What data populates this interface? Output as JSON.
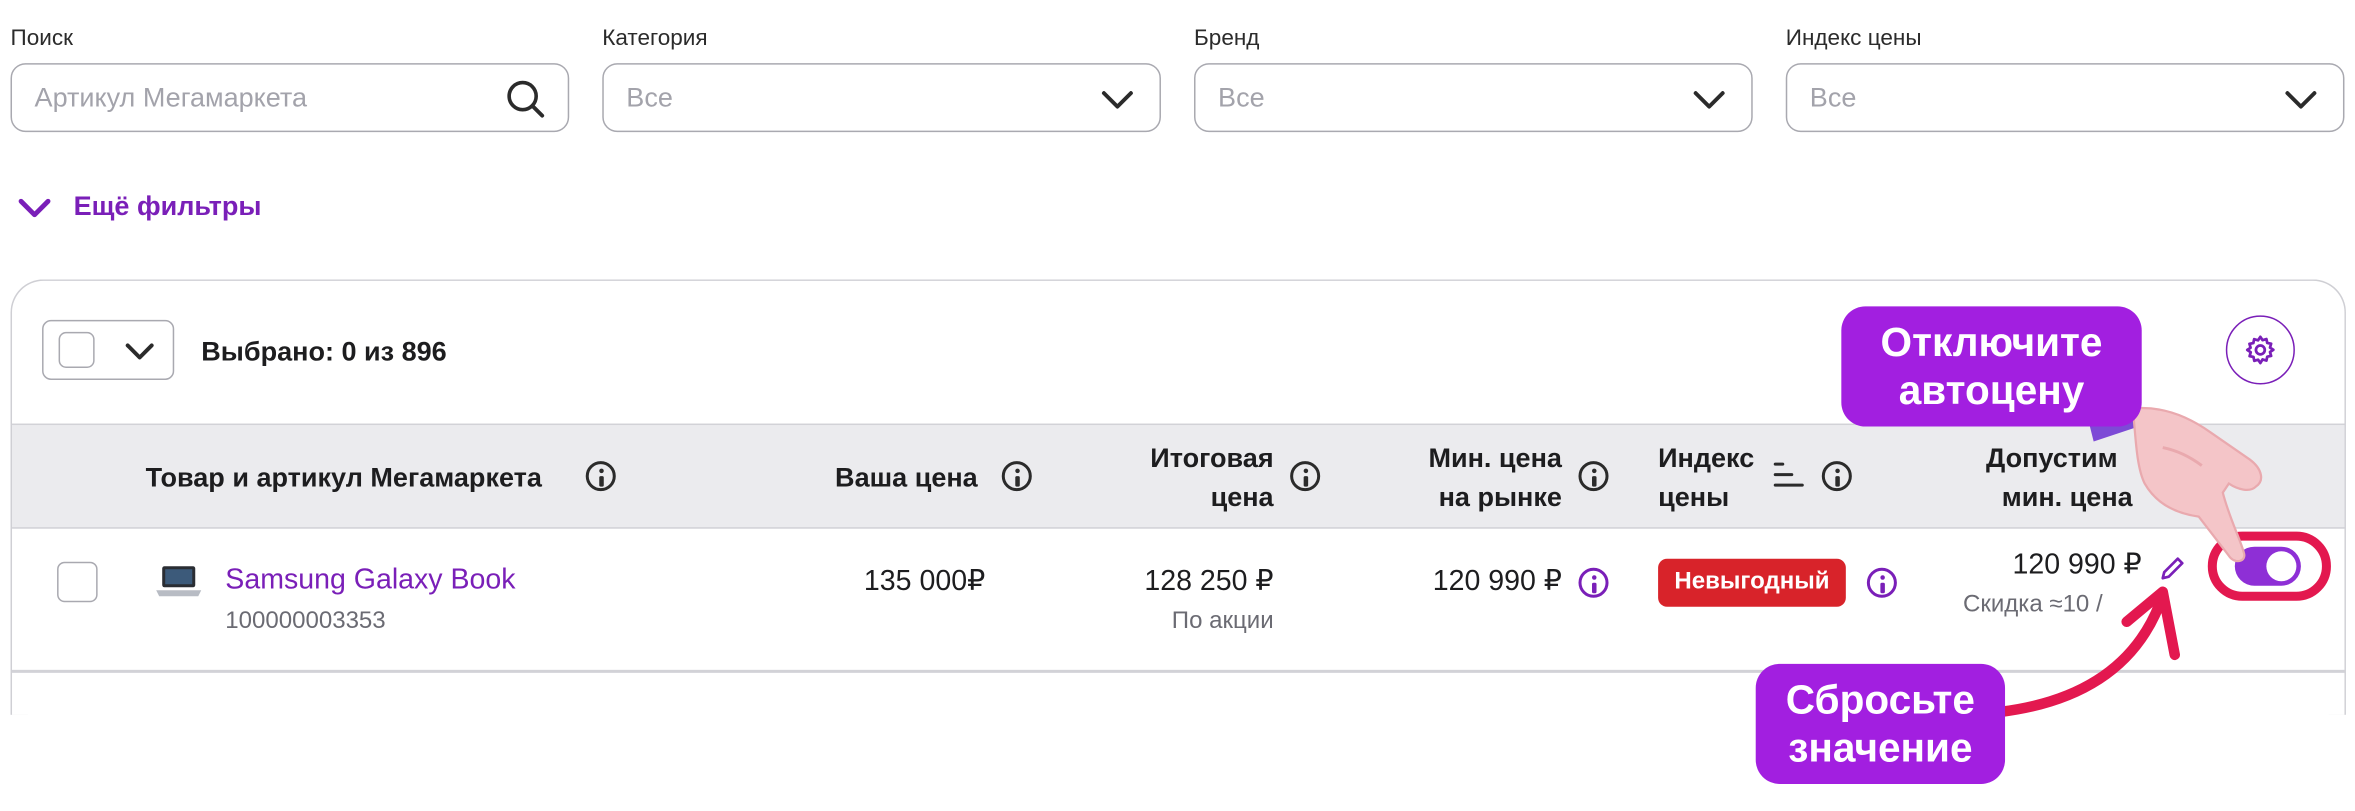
{
  "filters": {
    "search": {
      "label": "Поиск",
      "placeholder": "Артикул Мегамаркета"
    },
    "category": {
      "label": "Категория",
      "value": "Все"
    },
    "brand": {
      "label": "Бренд",
      "value": "Все"
    },
    "price_index": {
      "label": "Индекс цены",
      "value": "Все"
    },
    "more_filters": "Ещё фильтры"
  },
  "table": {
    "selected_text": "Выбрано: 0 из 896",
    "headers": {
      "product": "Товар и артикул Мегамаркета",
      "your_price": "Ваша цена",
      "final_price_1": "Итоговая",
      "final_price_2": "цена",
      "min_price_1": "Мин. цена",
      "min_price_2": "на рынке",
      "index_1": "Индекс",
      "index_2": "цены",
      "allowed_1": "Допустим",
      "allowed_2": "мин. цена"
    },
    "row": {
      "name": "Samsung Galaxy Book",
      "sku": "100000003353",
      "your_price": "135 000₽",
      "final_price": "128 250 ₽",
      "final_note": "По акции",
      "min_market": "120 990 ₽",
      "index_badge": "Невыгодный",
      "allowed_min": "120 990 ₽",
      "discount": "Скидка ≈10 /"
    }
  },
  "callouts": {
    "top_1": "Отключите",
    "top_2": "автоцену",
    "bottom_1": "Сбросьте",
    "bottom_2": "значение"
  },
  "colors": {
    "accent": "#7a1fb8",
    "callout": "#a21fe0",
    "badge": "#d8232a",
    "highlight_ring": "#e3184f"
  }
}
